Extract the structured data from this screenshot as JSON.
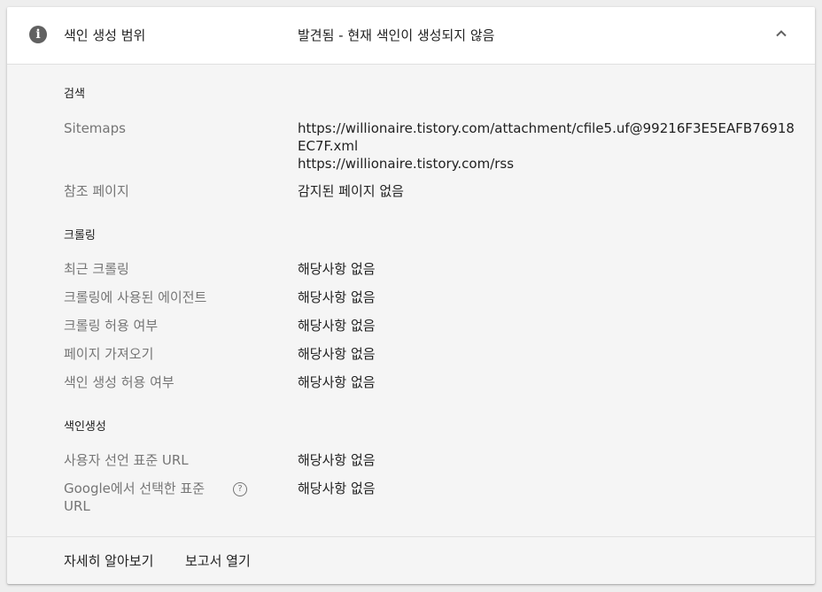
{
  "header": {
    "icon": "info-icon",
    "title": "색인 생성 범위",
    "status": "발견됨 - 현재 색인이 생성되지 않음",
    "collapse_icon": "chevron-up-icon"
  },
  "sections": [
    {
      "title": "검색",
      "rows": [
        {
          "label": "Sitemaps",
          "values": [
            "https://willionaire.tistory.com/attachment/cfile5.uf@99216F3E5EAFB76918EC7F.xml",
            "https://willionaire.tistory.com/rss"
          ]
        },
        {
          "label": "참조 페이지",
          "value": "감지된 페이지 없음"
        }
      ]
    },
    {
      "title": "크롤링",
      "rows": [
        {
          "label": "최근 크롤링",
          "value": "해당사항 없음"
        },
        {
          "label": "크롤링에 사용된 에이전트",
          "value": "해당사항 없음"
        },
        {
          "label": "크롤링 허용 여부",
          "value": "해당사항 없음"
        },
        {
          "label": "페이지 가져오기",
          "value": "해당사항 없음"
        },
        {
          "label": "색인 생성 허용 여부",
          "value": "해당사항 없음"
        }
      ]
    },
    {
      "title": "색인생성",
      "rows": [
        {
          "label": "사용자 선언 표준 URL",
          "value": "해당사항 없음"
        },
        {
          "label": "Google에서 선택한 표준 URL",
          "value": "해당사항 없음",
          "help_icon": "help-icon",
          "help_glyph": "?"
        }
      ]
    }
  ],
  "footer": {
    "learn_more": "자세히 알아보기",
    "open_report": "보고서 열기"
  }
}
